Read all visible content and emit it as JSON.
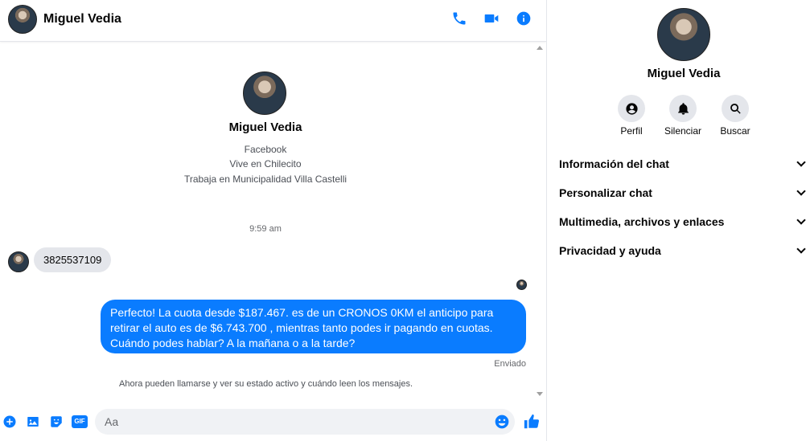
{
  "contact": {
    "name": "Miguel Vedia",
    "source": "Facebook",
    "lives": "Vive en Chilecito",
    "works": "Trabaja en Municipalidad Villa Castelli"
  },
  "thread": {
    "timestamp": "9:59 am",
    "incoming_message": "3825537109",
    "outgoing_message": "Perfecto! La cuota desde $187.467. es de un CRONOS 0KM el anticipo para retirar el auto es de $6.743.700 , mientras tanto podes ir pagando en cuotas. Cuándo podes hablar? A la mañana o a la tarde?",
    "sent_status": "Enviado",
    "system_message": "Ahora pueden llamarse y ver su estado activo y cuándo leen los mensajes."
  },
  "composer": {
    "placeholder": "Aa",
    "gif_label": "GIF"
  },
  "panel": {
    "actions": [
      "Perfil",
      "Silenciar",
      "Buscar"
    ],
    "sections": [
      "Información del chat",
      "Personalizar chat",
      "Multimedia, archivos y enlaces",
      "Privacidad y ayuda"
    ]
  },
  "colors": {
    "accent": "#0a7cff",
    "bubble_in": "#e4e6eb",
    "input_bg": "#f0f2f5"
  },
  "icons": [
    "phone-icon",
    "video-icon",
    "info-icon",
    "plus-icon",
    "image-icon",
    "sticker-icon",
    "gif-icon",
    "emoji-icon",
    "like-icon",
    "profile-icon",
    "bell-icon",
    "search-icon",
    "chevron-down-icon"
  ]
}
